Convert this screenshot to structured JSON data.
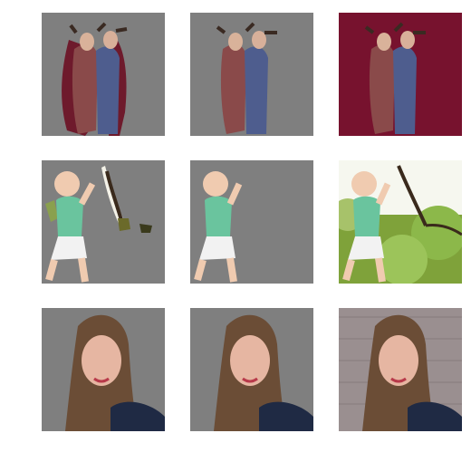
{
  "figure": {
    "rows": [
      {
        "subject": "two-women-lying",
        "panels": [
          {
            "variant": "coarse-mask",
            "background": "gray",
            "hex_bg": "#7f7f7f"
          },
          {
            "variant": "refined-mask",
            "background": "gray",
            "hex_bg": "#7f7f7f"
          },
          {
            "variant": "original-image",
            "background": "red-fur",
            "hex_bg": "#6e0f28"
          }
        ]
      },
      {
        "subject": "child-jumping",
        "panels": [
          {
            "variant": "coarse-mask",
            "background": "gray",
            "hex_bg": "#7f7f7f"
          },
          {
            "variant": "refined-mask",
            "background": "gray",
            "hex_bg": "#7f7f7f"
          },
          {
            "variant": "original-image",
            "background": "trees-sky",
            "hex_bg": "#9fb860"
          }
        ]
      },
      {
        "subject": "woman-portrait",
        "panels": [
          {
            "variant": "coarse-mask",
            "background": "gray",
            "hex_bg": "#7f7f7f"
          },
          {
            "variant": "refined-mask",
            "background": "gray",
            "hex_bg": "#7f7f7f"
          },
          {
            "variant": "original-image",
            "background": "brick-wall",
            "hex_bg": "#9a8f90"
          }
        ]
      }
    ]
  }
}
